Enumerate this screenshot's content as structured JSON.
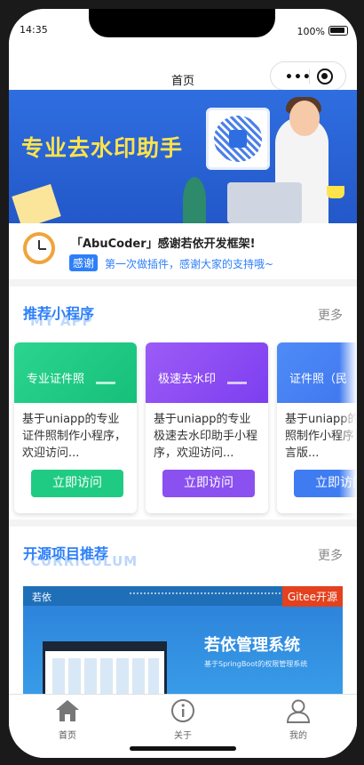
{
  "status": {
    "time": "14:35",
    "battery": "100%"
  },
  "nav": {
    "title": "首页"
  },
  "banner": {
    "title": "专业去水印助手",
    "dots": 2,
    "active_dot": 1
  },
  "notice": {
    "title": "「AbuCoder」感谢若依开发框架!",
    "tag": "感谢",
    "text": "第一次做插件，感谢大家的支持哦~"
  },
  "mini": {
    "title": "推荐小程序",
    "bg_text": "MY APP",
    "more": "更多",
    "cards": [
      {
        "name": "专业证件照",
        "desc": "基于uniapp的专业证件照制作小程序，欢迎访问...",
        "button": "立即访问",
        "color": "#1fcb83"
      },
      {
        "name": "极速去水印",
        "desc": "基于uniapp的专业极速去水印助手小程序，欢迎访问...",
        "button": "立即访问",
        "color": "#8b50f0"
      },
      {
        "name": "证件照（民",
        "desc": "基于uniapp的证件照制作小程序民族语言版...",
        "button": "立即访问",
        "color": "#3f7cf2"
      }
    ]
  },
  "open": {
    "title": "开源项目推荐",
    "bg_text": "CURRICULUM",
    "more": "更多",
    "project": {
      "brand": "若依",
      "name": "若依管理系统",
      "subtitle": "基于SpringBoot的权限管理系统",
      "badge": "Gitee开源"
    }
  },
  "tabs": [
    {
      "label": "首页",
      "icon": "home-icon",
      "active": true
    },
    {
      "label": "关于",
      "icon": "info-icon",
      "active": false
    },
    {
      "label": "我的",
      "icon": "user-icon",
      "active": false
    }
  ]
}
